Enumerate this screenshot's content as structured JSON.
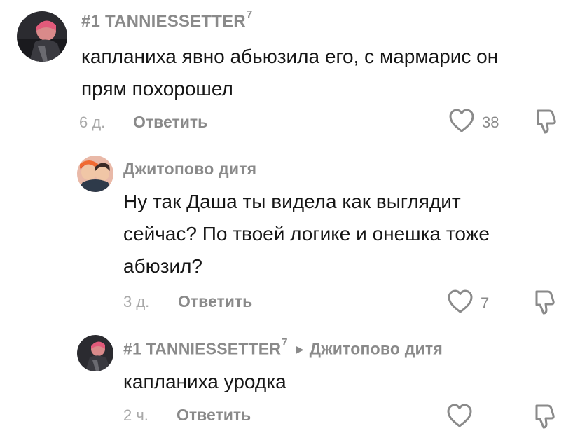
{
  "comments": [
    {
      "author": "#1 TANNIESSETTER",
      "badge": "7",
      "lines": [
        "капланиха явно абьюзила его, с мармарис он",
        "прям похорошел"
      ],
      "time": "6 д.",
      "reply_label": "Ответить",
      "likes": "38"
    },
    {
      "author": "Джитопово дитя",
      "lines": [
        "Ну так Даша ты видела как выглядит",
        "сейчас? По твоей логике и онешка тоже",
        "абюзил?"
      ],
      "time": "3 д.",
      "reply_label": "Ответить",
      "likes": "7"
    },
    {
      "author": "#1 TANNIESSETTER",
      "badge": "7",
      "reply_to": "Джитопово дитя",
      "lines": [
        "капланиха уродка"
      ],
      "time": "2 ч.",
      "reply_label": "Ответить",
      "likes": ""
    }
  ],
  "icons": {
    "like": "heart-outline-icon",
    "dislike": "thumbs-down-icon",
    "reply_arrow": "triangle-right-icon"
  },
  "colors": {
    "secondary_text": "#8a8a8a",
    "time_text": "#a8a8a8",
    "body_text": "#161616"
  }
}
